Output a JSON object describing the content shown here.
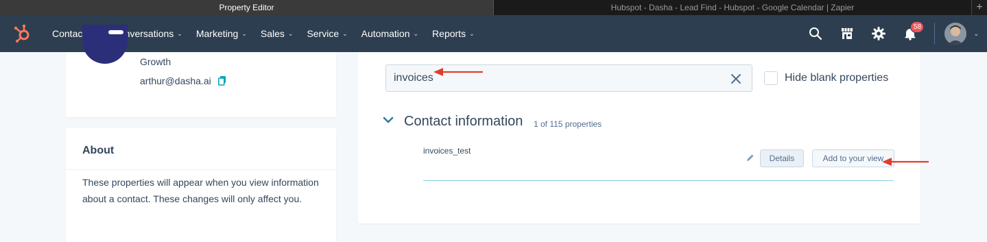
{
  "browser_tabs": [
    {
      "label": "Property Editor",
      "active": true
    },
    {
      "label": "Hubspot - Dasha - Lead Find - Hubspot - Google Calendar | Zapier",
      "active": false
    }
  ],
  "new_tab_glyph": "+",
  "nav": {
    "items": [
      {
        "label": "Contacts"
      },
      {
        "label": "Conversations"
      },
      {
        "label": "Marketing"
      },
      {
        "label": "Sales"
      },
      {
        "label": "Service"
      },
      {
        "label": "Automation"
      },
      {
        "label": "Reports"
      }
    ],
    "icons": [
      "search-icon",
      "marketplace-icon",
      "settings-icon",
      "notifications-icon"
    ],
    "notification_count": "58",
    "brand_color": "#ff7a59",
    "nav_bg": "#2d3e50"
  },
  "profile": {
    "company": "Growth",
    "email": "arthur@dasha.ai"
  },
  "about": {
    "title": "About",
    "description": "These properties will appear when you view information about a contact. These changes will only affect you."
  },
  "search": {
    "value": "invoices",
    "hide_blank_label": "Hide blank properties",
    "hide_blank_checked": false
  },
  "section": {
    "title": "Contact information",
    "count": "1 of 115 properties",
    "expanded": true
  },
  "property": {
    "name": "invoices_test",
    "details_label": "Details",
    "add_label": "Add to your view"
  },
  "annotation_color": "#e03e2d"
}
